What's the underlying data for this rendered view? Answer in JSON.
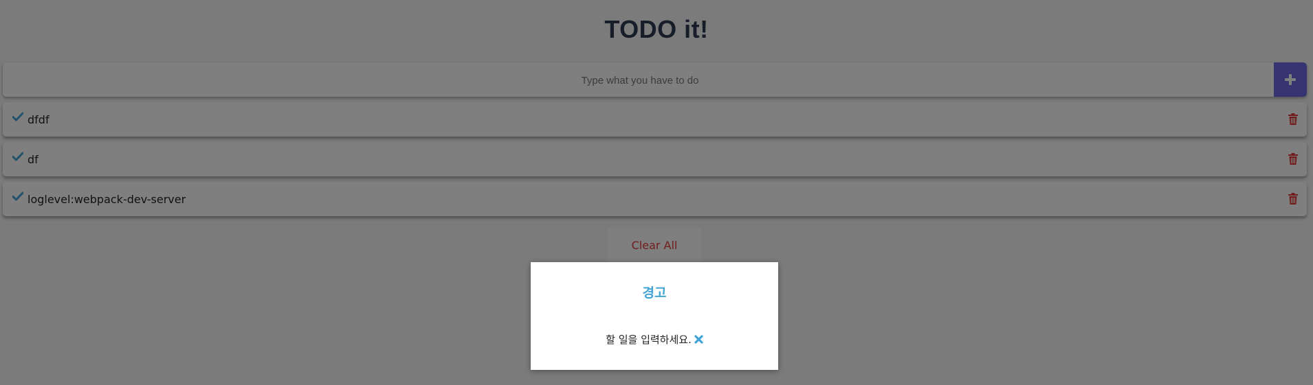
{
  "header": {
    "title": "TODO it!"
  },
  "input": {
    "placeholder": "Type what you have to do",
    "value": ""
  },
  "todos": [
    {
      "text": "dfdf"
    },
    {
      "text": "df"
    },
    {
      "text": "loglevel:webpack-dev-server"
    }
  ],
  "actions": {
    "clear_all_label": "Clear All"
  },
  "modal": {
    "title": "경고",
    "message": "할 일을 입력하세요."
  },
  "icons": {
    "add": "plus-icon",
    "check": "check-icon",
    "delete": "trash-icon",
    "close": "close-icon"
  },
  "colors": {
    "accent": "#6a66e0",
    "check": "#42a3d6",
    "danger": "#e23b3b",
    "title": "#2f3b52",
    "modal_title": "#42a3d6"
  }
}
